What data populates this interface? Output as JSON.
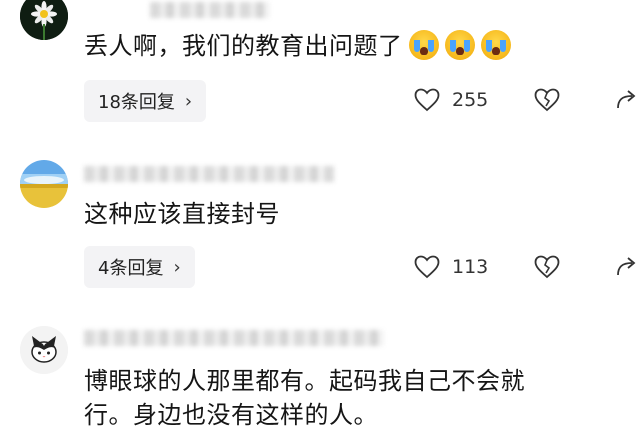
{
  "comments": [
    {
      "text": "丢人啊，我们的教育出问题了",
      "emoji": [
        "crying-face",
        "crying-face",
        "crying-face"
      ],
      "replies_label": "18条回复",
      "like_count": "255"
    },
    {
      "text": "这种应该直接封号",
      "replies_label": "4条回复",
      "like_count": "113"
    },
    {
      "text_line1": "博眼球的人那里都有。起码我自己不会就",
      "text_line2": "行。身边也没有这样的人。"
    }
  ]
}
